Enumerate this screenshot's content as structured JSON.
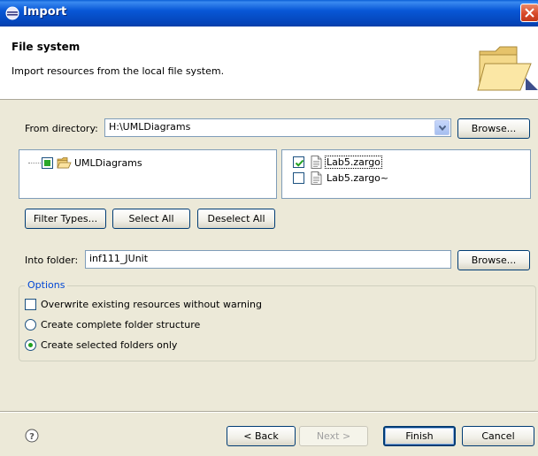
{
  "window": {
    "title": "Import"
  },
  "banner": {
    "heading": "File system",
    "description": "Import resources from the local file system."
  },
  "from_directory": {
    "label": "From directory:",
    "value": "H:\\UMLDiagrams",
    "browse_label": "Browse..."
  },
  "tree": {
    "items": [
      {
        "label": "UMLDiagrams",
        "state": "partial"
      }
    ]
  },
  "files": {
    "items": [
      {
        "label": "Lab5.zargo",
        "checked": true
      },
      {
        "label": "Lab5.zargo~",
        "checked": false
      }
    ]
  },
  "selection_buttons": {
    "filter_types": "Filter Types...",
    "select_all": "Select All",
    "deselect_all": "Deselect All"
  },
  "into_folder": {
    "label": "Into folder:",
    "value": "inf111_JUnit",
    "browse_label": "Browse..."
  },
  "options": {
    "title": "Options",
    "overwrite": {
      "label": "Overwrite existing resources without warning",
      "checked": false
    },
    "complete_structure": {
      "label": "Create complete folder structure",
      "selected": false
    },
    "selected_only": {
      "label": "Create selected folders only",
      "selected": true
    }
  },
  "footer": {
    "back": "< Back",
    "next": "Next >",
    "finish": "Finish",
    "cancel": "Cancel"
  },
  "icons": {
    "app": "eclipse-icon",
    "close": "close-icon",
    "banner": "open-folder-icon",
    "help": "help-icon"
  },
  "colors": {
    "titlebar": "#0857d6",
    "group_title": "#0046d5",
    "check": "#21a121"
  }
}
